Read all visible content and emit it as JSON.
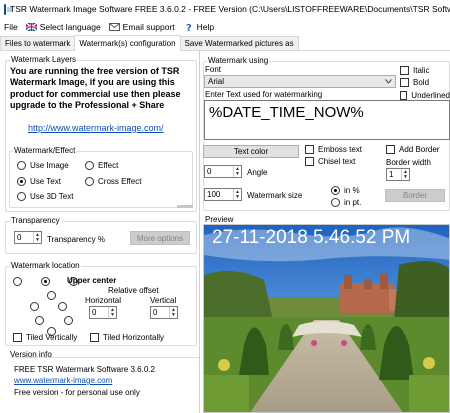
{
  "window": {
    "title": "TSR Watermark Image Software FREE 3.6.0.2 - FREE Version (C:\\Users\\LISTOFFREEWARE\\Documents\\TSR Software\\defaul"
  },
  "menu": {
    "file": "File",
    "language": "Select language",
    "email": "Email support",
    "help": "Help"
  },
  "tabs": [
    "Files to watermark",
    "Watermark(s) configuration",
    "Save Watermarked pictures as"
  ],
  "watermark_layers": {
    "title": "Watermark Layers",
    "notice": "You are running the free version of TSR Watermark Image, if you are using this product for commercial use then please upgrade to the Professional + Share",
    "link": "http://www.watermark-image.com/"
  },
  "effect": {
    "title": "Watermark/Effect",
    "options": [
      "Use Image",
      "Effect",
      "Use Text",
      "Cross Effect",
      "Use 3D Text"
    ],
    "selected": "Use Text"
  },
  "transparency": {
    "title": "Transparency",
    "value": "0",
    "label": "Transparency %",
    "more_button": "More options"
  },
  "location": {
    "title": "Watermark location",
    "position_label": "Upper center",
    "relative_offset": "Relative offset",
    "horizontal_label": "Horizontal",
    "vertical_label": "Vertical",
    "horizontal_value": "0",
    "vertical_value": "0",
    "tiled_vertically": "Tiled Vertically",
    "tiled_horizontally": "Tiled Horizontally"
  },
  "version": {
    "title": "Version info",
    "name": "FREE TSR Watermark Software 3.6.0.2",
    "link": "www.watermark-image.com",
    "note": "Free version - for personal use only"
  },
  "watermark_using": {
    "title": "Watermark using",
    "font_label": "Font",
    "font_value": "Arial",
    "italic": "Italic",
    "bold": "Bold",
    "underline": "Underlined",
    "text_label": "Enter Text used for watermarking",
    "text_value": "%DATE_TIME_NOW%",
    "text_color_button": "Text color",
    "emboss": "Emboss text",
    "chisel": "Chisel text",
    "add_border": "Add Border",
    "border_width_label": "Border width",
    "border_width_value": "1",
    "border_button": "Border",
    "angle_value": "0",
    "angle_label": "Angle",
    "size_value": "100",
    "size_label": "Watermark size",
    "unit_percent": "in %",
    "unit_pt": "in pt."
  },
  "preview": {
    "title": "Preview",
    "overlay_text": "27-11-2018 5.46.52 PM"
  },
  "colors": {
    "link": "#0b4fb3",
    "button_bg": "#e1e1e1",
    "disabled_bg": "#cccccc",
    "sky": "#3f86d8"
  }
}
